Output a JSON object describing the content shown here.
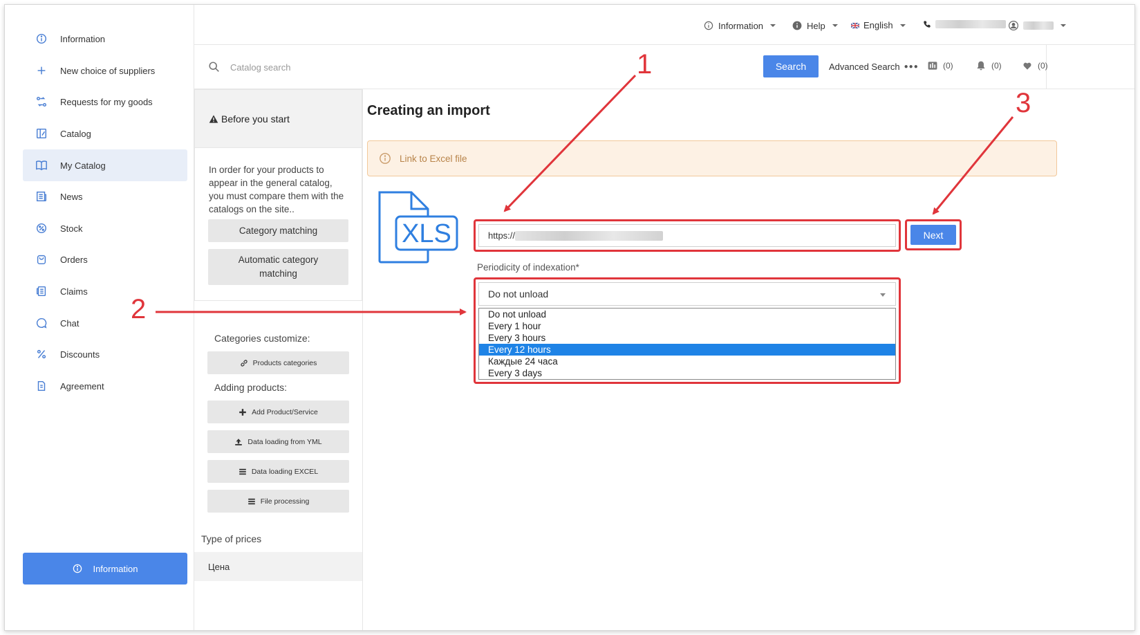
{
  "sidebar": {
    "items": [
      {
        "label": "Information",
        "icon": "info-icon"
      },
      {
        "label": "New choice of suppliers",
        "icon": "plus-icon"
      },
      {
        "label": "Requests for my goods",
        "icon": "exchange-icon"
      },
      {
        "label": "Catalog",
        "icon": "catalog-icon"
      },
      {
        "label": "My Catalog",
        "icon": "book-icon",
        "active": true
      },
      {
        "label": "News",
        "icon": "news-icon"
      },
      {
        "label": "Stock",
        "icon": "percent-circle-icon"
      },
      {
        "label": "Orders",
        "icon": "bag-icon"
      },
      {
        "label": "Claims",
        "icon": "claims-icon"
      },
      {
        "label": "Chat",
        "icon": "chat-icon"
      },
      {
        "label": "Discounts",
        "icon": "percent-icon"
      },
      {
        "label": "Agreement",
        "icon": "document-icon"
      }
    ],
    "info_button": "Information"
  },
  "topbar": {
    "information": "Information",
    "help": "Help",
    "language": "English"
  },
  "searchbar": {
    "placeholder": "Catalog search",
    "search_button": "Search",
    "advanced": "Advanced Search",
    "compare_count": "(0)",
    "notifications_count": "(0)",
    "favorites_count": "(0)"
  },
  "midcol": {
    "before_title": "Before you start",
    "before_text": "In order for your products to appear in the general catalog, you must compare them with the catalogs on the site..",
    "category_matching": "Category matching",
    "auto_matching": "Automatic category matching",
    "categories_customize": "Categories customize:",
    "products_categories": "Products categories",
    "adding_products": "Adding products:",
    "add_product": "Add Product/Service",
    "data_yml": "Data loading from YML",
    "data_excel": "Data loading EXCEL",
    "file_processing": "File processing",
    "type_of_prices": "Type of prices",
    "price_name": "Цена"
  },
  "main": {
    "title": "Creating an import",
    "alert": "Link to Excel file",
    "xls_label": "XLS",
    "url_value": "https://",
    "next_button": "Next",
    "period_label": "Periodicity of indexation*",
    "period_selected": "Do not unload",
    "period_options": [
      "Do not unload",
      "Every 1 hour",
      "Every 3 hours",
      "Every 12 hours",
      "Каждые 24 часа",
      "Every 3 days"
    ],
    "highlighted_option": "Every 12 hours"
  },
  "annotations": {
    "one": "1",
    "two": "2",
    "three": "3"
  },
  "colors": {
    "accent": "#4a86e8",
    "annotation": "#e0353b",
    "active_bg": "#e8eef8"
  }
}
